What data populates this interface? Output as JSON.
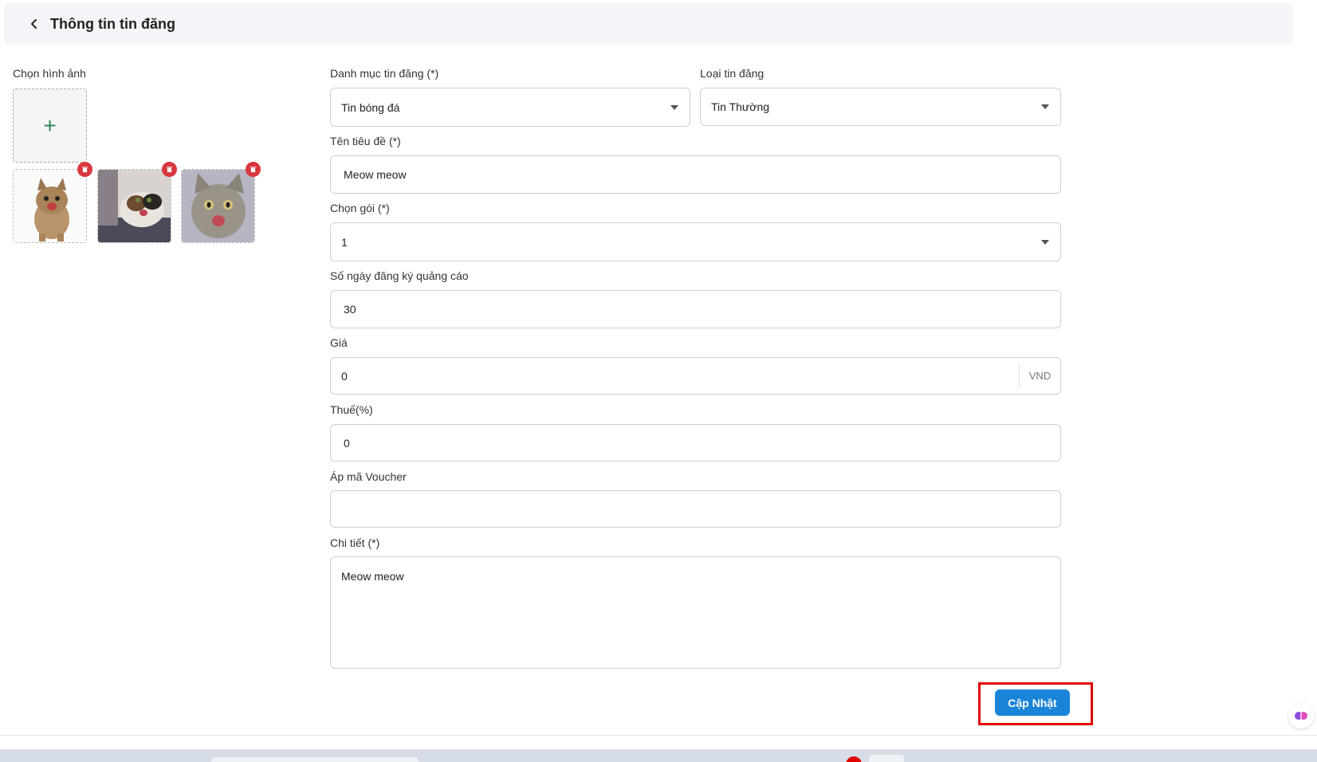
{
  "header": {
    "title": "Thông tin tin đăng"
  },
  "images": {
    "label": "Chọn hình ảnh",
    "thumbnails": [
      {
        "name": "kitten-standing"
      },
      {
        "name": "cat-on-blanket"
      },
      {
        "name": "cat-surprised"
      }
    ]
  },
  "form": {
    "category": {
      "label": "Danh mục tin đăng (*)",
      "value": "Tin bóng đá"
    },
    "type": {
      "label": "Loại tin đăng",
      "value": "Tin Thường"
    },
    "title": {
      "label": "Tên tiêu đề (*)",
      "value": "Meow meow"
    },
    "package": {
      "label": "Chọn gói (*)",
      "value": "1"
    },
    "days": {
      "label": "Số ngày đăng ký quảng cáo",
      "value": "30"
    },
    "price": {
      "label": "Giá",
      "value": "0",
      "suffix": "VND"
    },
    "tax": {
      "label": "Thuế(%)",
      "value": "0"
    },
    "voucher": {
      "label": "Áp mã Voucher",
      "value": ""
    },
    "detail": {
      "label": "Chi tiết (*)",
      "value": "Meow meow"
    }
  },
  "actions": {
    "update_label": "Cập Nhật"
  },
  "colors": {
    "primary": "#1a84d8",
    "highlight": "#e00000",
    "delete": "#d9363e"
  }
}
